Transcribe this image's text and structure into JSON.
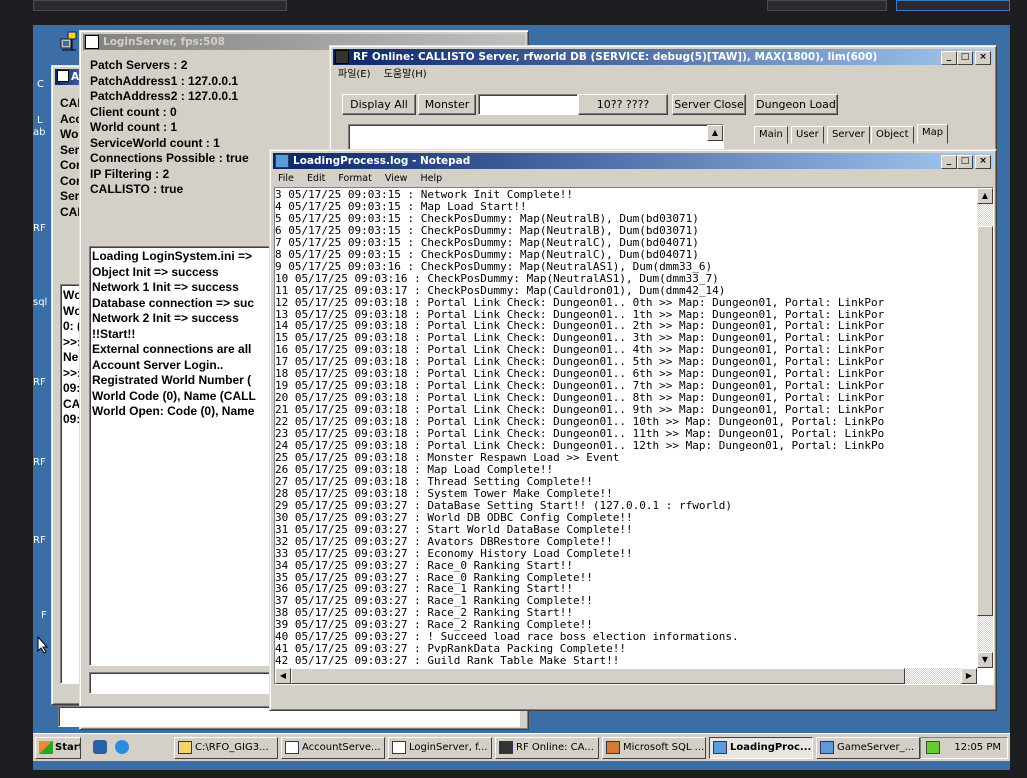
{
  "login_server": {
    "title": "LoginServer, fps:508",
    "info": [
      "Patch Servers : 2",
      "PatchAddress1 : 127.0.0.1",
      "PatchAddress2 : 127.0.0.1",
      "Client count : 0",
      "World count : 1",
      "ServiceWorld count : 1",
      "Connections Possible : true",
      "IP Filtering : 2",
      "CALLISTO : true"
    ],
    "log": [
      "Loading LoginSystem.ini =>",
      "Object Init => success",
      "Network 1 Init => success",
      "Database connection => suc",
      "Network 2 Init => success",
      "!!Start!!",
      "External connections are all",
      "Account Server Login..",
      "Registrated World Number (",
      "World Code (0), Name (CALL",
      "World Open: Code (0), Name"
    ]
  },
  "account_server": {
    "title_fragment": "Ac",
    "info": [
      "CAL",
      "Acc",
      "Wo",
      "Ser",
      "Cor",
      "Cor",
      "Ser",
      "CAL"
    ],
    "log": [
      "Wc",
      "Wc",
      "0: (",
      ">>:",
      "",
      "Ne",
      ">>:",
      "09:",
      "CA",
      "09:"
    ]
  },
  "rf_server": {
    "title": "RF Online: CALLISTO Server, rfworld DB (SERVICE: debug(5)[TAW]), MAX(1800), lim(600)",
    "menu": [
      "파일(E)",
      "도움말(H)"
    ],
    "buttons": {
      "display_all": "Display All",
      "monster": "Monster",
      "unknown": "10?? ????",
      "server_close": "Server Close",
      "dungeon_load": "Dungeon Load"
    },
    "tabs": [
      "Main",
      "User",
      "Server",
      "Object",
      "Map"
    ]
  },
  "notepad": {
    "title": "LoadingProcess.log - Notepad",
    "menu": [
      "File",
      "Edit",
      "Format",
      "View",
      "Help"
    ],
    "lines": [
      "3 05/17/25 09:03:15 : Network Init Complete!!",
      "4 05/17/25 09:03:15 : Map Load Start!!",
      "5 05/17/25 09:03:15 : CheckPosDummy: Map(NeutralB), Dum(bd03071)",
      "6 05/17/25 09:03:15 : CheckPosDummy: Map(NeutralB), Dum(bd03071)",
      "7 05/17/25 09:03:15 : CheckPosDummy: Map(NeutralC), Dum(bd04071)",
      "8 05/17/25 09:03:15 : CheckPosDummy: Map(NeutralC), Dum(bd04071)",
      "9 05/17/25 09:03:16 : CheckPosDummy: Map(NeutralAS1), Dum(dmm33_6)",
      "10 05/17/25 09:03:16 : CheckPosDummy: Map(NeutralAS1), Dum(dmm33_7)",
      "11 05/17/25 09:03:17 : CheckPosDummy: Map(Cauldron01), Dum(dmm42_14)",
      "12 05/17/25 09:03:18 : Portal Link Check: Dungeon01.. 0th >> Map: Dungeon01, Portal: LinkPor",
      "13 05/17/25 09:03:18 : Portal Link Check: Dungeon01.. 1th >> Map: Dungeon01, Portal: LinkPor",
      "14 05/17/25 09:03:18 : Portal Link Check: Dungeon01.. 2th >> Map: Dungeon01, Portal: LinkPor",
      "15 05/17/25 09:03:18 : Portal Link Check: Dungeon01.. 3th >> Map: Dungeon01, Portal: LinkPor",
      "16 05/17/25 09:03:18 : Portal Link Check: Dungeon01.. 4th >> Map: Dungeon01, Portal: LinkPor",
      "17 05/17/25 09:03:18 : Portal Link Check: Dungeon01.. 5th >> Map: Dungeon01, Portal: LinkPor",
      "18 05/17/25 09:03:18 : Portal Link Check: Dungeon01.. 6th >> Map: Dungeon01, Portal: LinkPor",
      "19 05/17/25 09:03:18 : Portal Link Check: Dungeon01.. 7th >> Map: Dungeon01, Portal: LinkPor",
      "20 05/17/25 09:03:18 : Portal Link Check: Dungeon01.. 8th >> Map: Dungeon01, Portal: LinkPor",
      "21 05/17/25 09:03:18 : Portal Link Check: Dungeon01.. 9th >> Map: Dungeon01, Portal: LinkPor",
      "22 05/17/25 09:03:18 : Portal Link Check: Dungeon01.. 10th >> Map: Dungeon01, Portal: LinkPo",
      "23 05/17/25 09:03:18 : Portal Link Check: Dungeon01.. 11th >> Map: Dungeon01, Portal: LinkPo",
      "24 05/17/25 09:03:18 : Portal Link Check: Dungeon01.. 12th >> Map: Dungeon01, Portal: LinkPo",
      "25 05/17/25 09:03:18 : Monster Respawn Load >> Event",
      "26 05/17/25 09:03:18 : Map Load Complete!!",
      "27 05/17/25 09:03:18 : Thread Setting Complete!!",
      "28 05/17/25 09:03:18 : System Tower Make Complete!!",
      "29 05/17/25 09:03:27 : DataBase Setting Start!! (127.0.0.1 : rfworld)",
      "30 05/17/25 09:03:27 : World DB ODBC Config Complete!!",
      "31 05/17/25 09:03:27 : Start World DataBase Complete!!",
      "32 05/17/25 09:03:27 : Avators DBRestore Complete!!",
      "33 05/17/25 09:03:27 : Economy History Load Complete!!",
      "34 05/17/25 09:03:27 : Race_0 Ranking Start!!",
      "35 05/17/25 09:03:27 : Race_0 Ranking Complete!!",
      "36 05/17/25 09:03:27 : Race_1 Ranking Start!!",
      "37 05/17/25 09:03:27 : Race_1 Ranking Complete!!",
      "38 05/17/25 09:03:27 : Race_2 Ranking Start!!",
      "39 05/17/25 09:03:27 : Race_2 Ranking Complete!!",
      "40 05/17/25 09:03:27 : ! Succeed load race boss election informations.",
      "41 05/17/25 09:03:27 : PvpRankData Packing Complete!!",
      "42 05/17/25 09:03:27 : Guild Rank Table Make Start!!"
    ]
  },
  "desktop_labels": [
    "C",
    "L",
    "ab",
    "RF",
    "sql",
    "RF",
    "RF",
    "RF",
    "F"
  ],
  "taskbar": {
    "start": "Start",
    "tasks": [
      "C:\\RFO_GIG3...",
      "AccountServe...",
      "LoginServer, f...",
      "RF Online: CA...",
      "Microsoft SQL ...",
      "LoadingProc...",
      "GameServer_..."
    ],
    "clock": "12:05 PM"
  },
  "colors": {
    "desktop": "#3a6ea5",
    "title_active": "#0a246a",
    "window_face": "#d4d0c8"
  }
}
